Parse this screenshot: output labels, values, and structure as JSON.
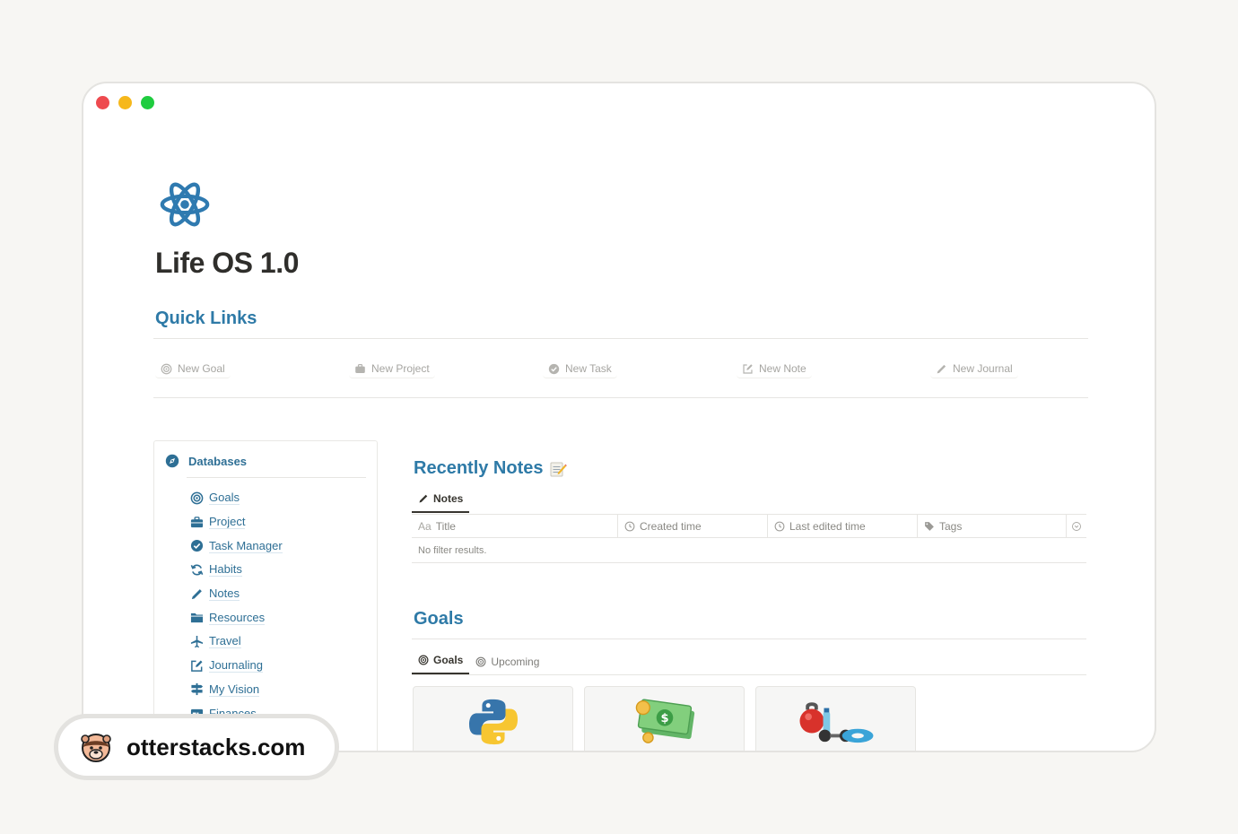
{
  "page": {
    "title": "Life OS 1.0"
  },
  "quick_links": {
    "heading": "Quick Links",
    "items": [
      {
        "label": "New Goal",
        "icon": "target-icon"
      },
      {
        "label": "New Project",
        "icon": "briefcase-icon"
      },
      {
        "label": "New Task",
        "icon": "check-circle-icon"
      },
      {
        "label": "New Note",
        "icon": "edit-square-icon"
      },
      {
        "label": "New Journal",
        "icon": "pencil-icon"
      }
    ]
  },
  "databases": {
    "heading": "Databases",
    "items": [
      {
        "label": "Goals",
        "icon": "target-icon"
      },
      {
        "label": "Project",
        "icon": "briefcase-icon"
      },
      {
        "label": "Task Manager",
        "icon": "check-circle-icon"
      },
      {
        "label": "Habits",
        "icon": "refresh-icon"
      },
      {
        "label": "Notes",
        "icon": "pencil-icon"
      },
      {
        "label": "Resources",
        "icon": "folder-icon"
      },
      {
        "label": "Travel",
        "icon": "airplane-icon"
      },
      {
        "label": "Journaling",
        "icon": "edit-square-icon"
      },
      {
        "label": "My Vision",
        "icon": "signpost-icon"
      },
      {
        "label": "Finances",
        "icon": "card-icon"
      }
    ]
  },
  "recent_notes": {
    "heading": "Recently Notes",
    "tab": "Notes",
    "columns": [
      {
        "label": "Title",
        "prefix": "Aa"
      },
      {
        "label": "Created time",
        "icon": "clock-icon"
      },
      {
        "label": "Last edited time",
        "icon": "clock-icon"
      },
      {
        "label": "Tags",
        "icon": "tag-icon"
      }
    ],
    "empty_text": "No filter results."
  },
  "goals": {
    "heading": "Goals",
    "tabs": [
      {
        "label": "Goals",
        "active": true
      },
      {
        "label": "Upcoming",
        "active": false
      }
    ],
    "cards": [
      {
        "image": "python-logo-icon"
      },
      {
        "image": "money-icon"
      },
      {
        "image": "fitness-icon"
      }
    ]
  },
  "watermark": {
    "text": "otterstacks.com"
  },
  "colors": {
    "accent": "#2e7aa7",
    "link": "#2e6f95",
    "window_bg": "#ffffff",
    "page_bg": "#f7f6f3"
  }
}
